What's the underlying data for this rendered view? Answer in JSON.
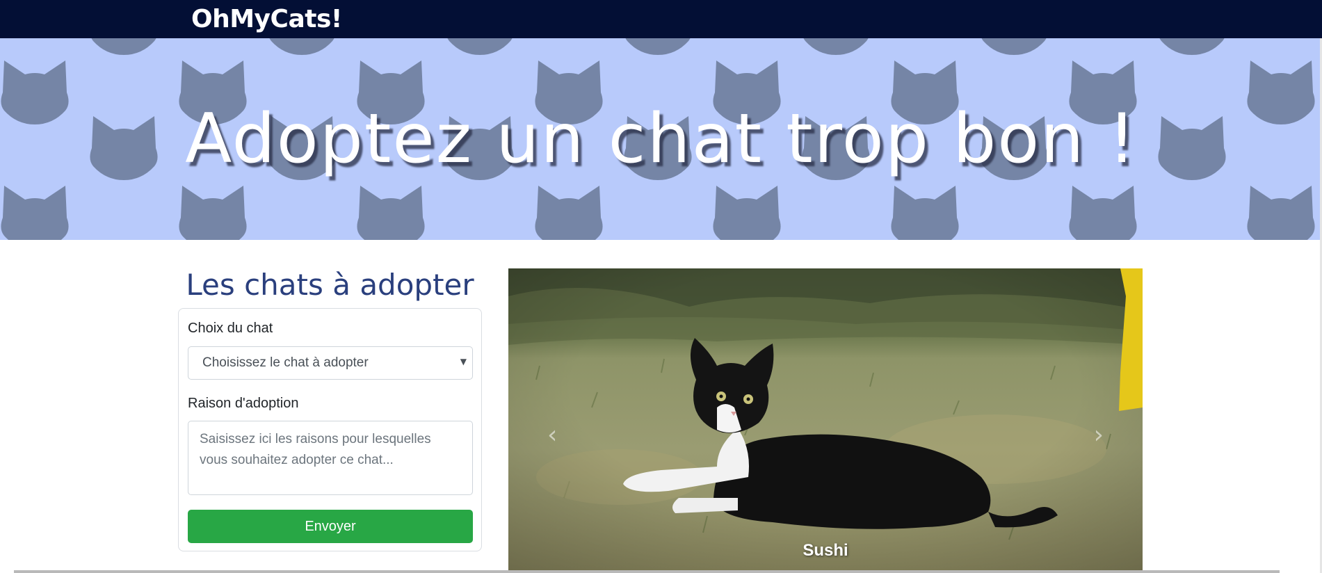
{
  "navbar": {
    "brand": "OhMyCats!"
  },
  "hero": {
    "title": "Adoptez un chat trop bon !",
    "background_color": "#b8cafb",
    "pattern_icon": "cat-head-icon",
    "pattern_color": "#7585a6"
  },
  "adoption": {
    "section_title": "Les chats à adopter",
    "cat_select_label": "Choix du chat",
    "cat_select_value": "Choisissez le chat à adopter",
    "reason_label": "Raison d'adoption",
    "reason_placeholder": "Saisissez ici les raisons pour lesquelles vous souhaitez adopter ce chat...",
    "submit_label": "Envoyer",
    "submit_color": "#28a745"
  },
  "carousel": {
    "caption": "Sushi",
    "prev_icon": "chevron-left-icon",
    "next_icon": "chevron-right-icon"
  },
  "colors": {
    "navbar": "#030f35",
    "heading": "#2a3f7d"
  }
}
